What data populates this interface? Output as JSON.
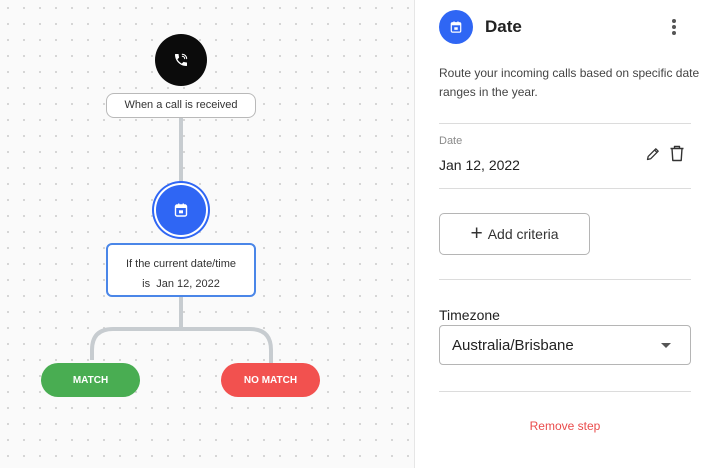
{
  "colors": {
    "accent_blue": "#2f66f4",
    "match_green": "#49ad52",
    "nomatch_red": "#f2514f",
    "danger_text": "#ea4b4b"
  },
  "canvas": {
    "trigger": {
      "icon": "phone-icon",
      "label": "When a call is received"
    },
    "step": {
      "icon": "calendar-icon",
      "condition_line1": "If the current date/time",
      "condition_line2": "is  Jan 12, 2022"
    },
    "branches": {
      "match": "MATCH",
      "no_match": "NO MATCH"
    }
  },
  "panel": {
    "icon": "calendar-icon",
    "title": "Date",
    "menu_icon": "kebab-menu-icon",
    "description": "Route your incoming calls based on specific date ranges in the year.",
    "criterion": {
      "label": "Date",
      "value": "Jan 12, 2022"
    },
    "add_criteria_label": "Add criteria",
    "timezone": {
      "label": "Timezone",
      "value": "Australia/Brisbane"
    },
    "remove_label": "Remove step"
  }
}
